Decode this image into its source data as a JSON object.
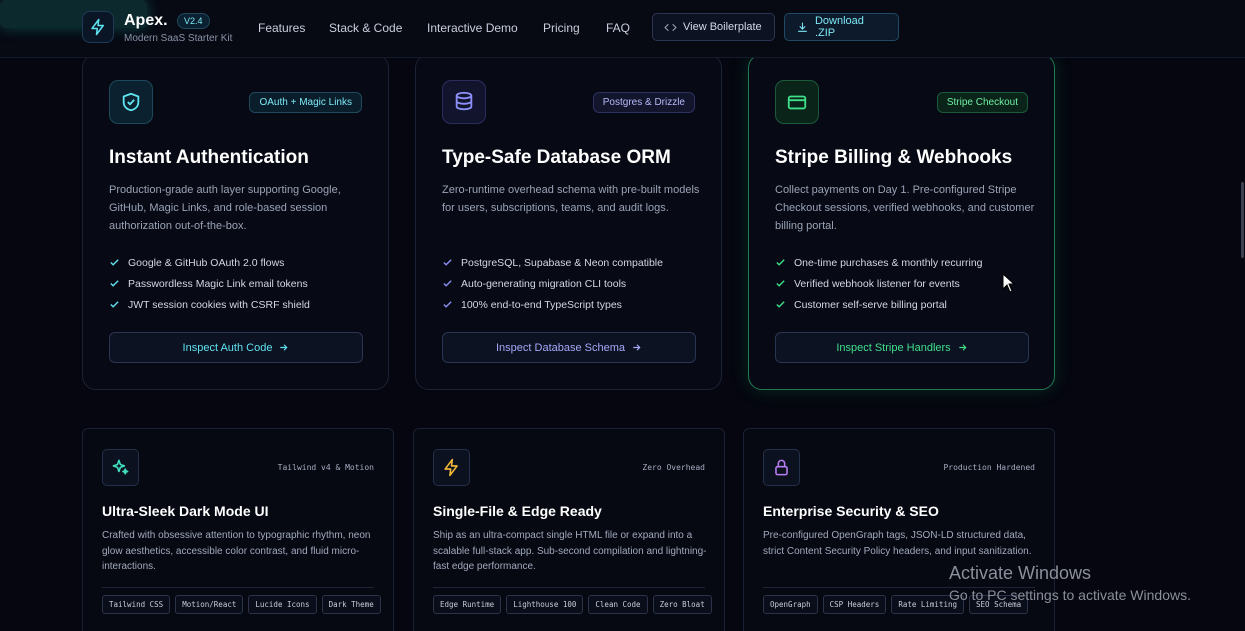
{
  "header": {
    "brand": "Apex.",
    "version": "V2.4",
    "tagline": "Modern SaaS Starter Kit",
    "nav": [
      "Features",
      "Stack & Code",
      "Interactive Demo",
      "Pricing",
      "FAQ"
    ],
    "view_button": "View Boilerplate",
    "download_button": "Download .ZIP"
  },
  "cards": [
    {
      "pill": "OAuth + Magic Links",
      "title": "Instant Authentication",
      "desc": "Production-grade auth layer supporting Google, GitHub, Magic Links, and role-based session authorization out-of-the-box.",
      "features": [
        "Google & GitHub OAuth 2.0 flows",
        "Passwordless Magic Link email tokens",
        "JWT session cookies with CSRF shield"
      ],
      "button": "Inspect Auth Code",
      "icon": "shield-check-icon"
    },
    {
      "pill": "Postgres & Drizzle",
      "title": "Type-Safe Database ORM",
      "desc": "Zero-runtime overhead schema with pre-built models for users, subscriptions, teams, and audit logs.",
      "features": [
        "PostgreSQL, Supabase & Neon compatible",
        "Auto-generating migration CLI tools",
        "100% end-to-end TypeScript types"
      ],
      "button": "Inspect Database Schema",
      "icon": "database-icon"
    },
    {
      "pill": "Stripe Checkout",
      "title": "Stripe Billing & Webhooks",
      "desc": "Collect payments on Day 1. Pre-configured Stripe Checkout sessions, verified webhooks, and customer billing portal.",
      "features": [
        "One-time purchases & monthly recurring",
        "Verified webhook listener for events",
        "Customer self-serve billing portal"
      ],
      "button": "Inspect Stripe Handlers",
      "icon": "credit-card-icon"
    }
  ],
  "bottom_cards": [
    {
      "meta": "Tailwind v4 & Motion",
      "title": "Ultra-Sleek Dark Mode UI",
      "desc": "Crafted with obsessive attention to typographic rhythm, neon glow aesthetics, accessible color contrast, and fluid micro-interactions.",
      "tags": [
        "Tailwind CSS",
        "Motion/React",
        "Lucide Icons",
        "Dark Theme"
      ],
      "icon": "sparkles-icon"
    },
    {
      "meta": "Zero Overhead",
      "title": "Single-File & Edge Ready",
      "desc": "Ship as an ultra-compact single HTML file or expand into a scalable full-stack app. Sub-second compilation and lightning-fast edge performance.",
      "tags": [
        "Edge Runtime",
        "Lighthouse 100",
        "Clean Code",
        "Zero Bloat"
      ],
      "icon": "lightning-icon"
    },
    {
      "meta": "Production Hardened",
      "title": "Enterprise Security & SEO",
      "desc": "Pre-configured OpenGraph tags, JSON-LD structured data, strict Content Security Policy headers, and input sanitization.",
      "tags": [
        "OpenGraph",
        "CSP Headers",
        "Rate Limiting",
        "SEO Schema"
      ],
      "icon": "lock-icon"
    }
  ],
  "watermark": {
    "line1": "Activate Windows",
    "line2": "Go to PC settings to activate Windows."
  },
  "colors": {
    "cyan": "#5fe3f0",
    "indigo": "#8b8ff5",
    "green": "#3ee08a",
    "purple": "#b57cf0",
    "amber": "#f5b93a"
  }
}
